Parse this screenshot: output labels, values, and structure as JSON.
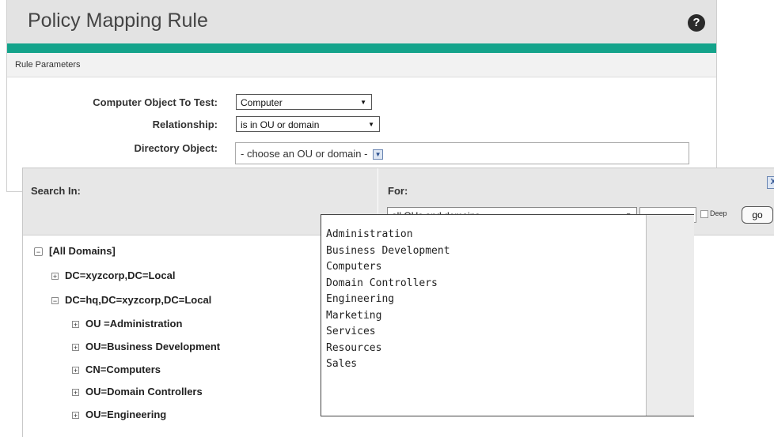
{
  "header": {
    "title": "Policy Mapping Rule",
    "help_icon": "?"
  },
  "section": {
    "title": "Rule Parameters"
  },
  "form": {
    "computer_object_label": "Computer Object To Test:",
    "computer_object_value": "Computer",
    "relationship_label": "Relationship:",
    "relationship_value": "is in OU or domain",
    "directory_object_label": "Directory Object:",
    "directory_object_placeholder": "- choose an OU or domain -",
    "select_arrow": "▼",
    "dropdown_button": "▼"
  },
  "search": {
    "search_in_label": "Search In:",
    "for_label": "For:",
    "close_icon": "X",
    "for_type_value": "all OUs and domains",
    "for_text_value": "",
    "deep_label": "Deep",
    "go_label": "go"
  },
  "tree": [
    {
      "label": "[All Domains]",
      "toggle": "−"
    },
    {
      "label": "DC=xyzcorp,DC=Local",
      "toggle": "+"
    },
    {
      "label": "DC=hq,DC=xyzcorp,DC=Local",
      "toggle": "−"
    },
    {
      "label": "OU =Administration",
      "toggle": "+"
    },
    {
      "label": "OU=Business Development",
      "toggle": "+"
    },
    {
      "label": "CN=Computers",
      "toggle": "+"
    },
    {
      "label": "OU=Domain Controllers",
      "toggle": "+"
    },
    {
      "label": "OU=Engineering",
      "toggle": "+"
    }
  ],
  "results": [
    "Administration",
    "Business Development",
    "Computers",
    "Domain Controllers",
    "Engineering",
    "Marketing",
    "Services",
    "Resources",
    "Sales"
  ],
  "colors": {
    "accent": "#14a38b",
    "title_bar": "#e3e3e3",
    "popup_header": "#e7e7e7"
  },
  "icons": {
    "help": "help-icon",
    "close": "close-icon",
    "expand": "plus-icon",
    "collapse": "minus-icon",
    "dropdown": "chevron-down-icon"
  }
}
